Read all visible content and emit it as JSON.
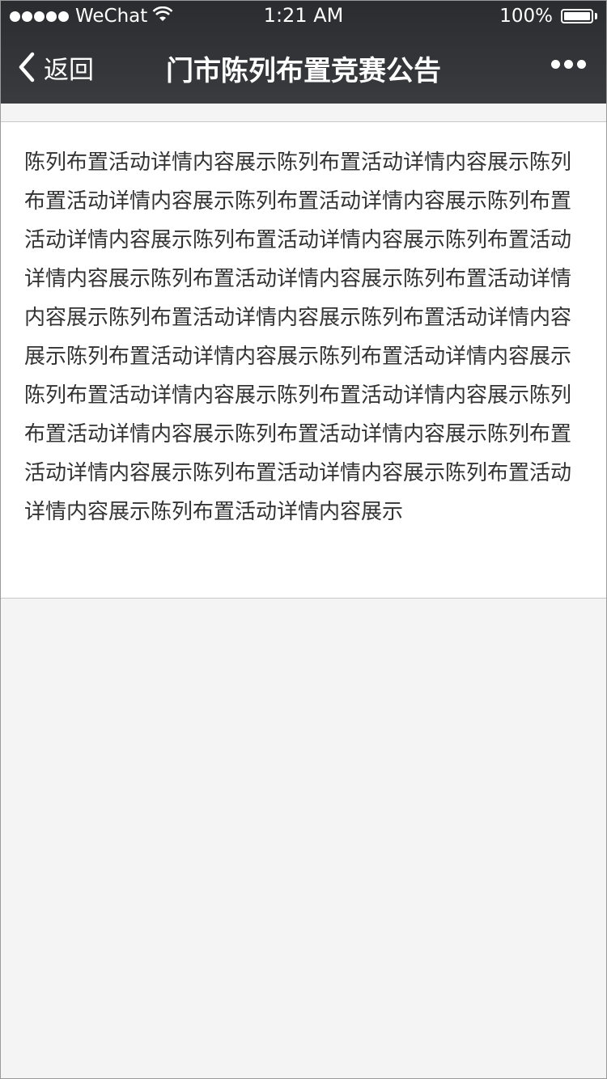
{
  "status_bar": {
    "carrier": "WeChat",
    "time": "1:21 AM",
    "battery": "100%",
    "signal_icon": "signal-dots-icon",
    "wifi_icon": "wifi-icon",
    "battery_icon": "battery-icon"
  },
  "nav": {
    "back_label": "返回",
    "title": "门市陈列布置竞赛公告",
    "more_icon": "more-icon",
    "back_icon": "chevron-left-icon"
  },
  "article": {
    "body": "陈列布置活动详情内容展示陈列布置活动详情内容展示陈列布置活动详情内容展示陈列布置活动详情内容展示陈列布置活动详情内容展示陈列布置活动详情内容展示陈列布置活动详情内容展示陈列布置活动详情内容展示陈列布置活动详情内容展示陈列布置活动详情内容展示陈列布置活动详情内容展示陈列布置活动详情内容展示陈列布置活动详情内容展示陈列布置活动详情内容展示陈列布置活动详情内容展示陈列布置活动详情内容展示陈列布置活动详情内容展示陈列布置活动详情内容展示陈列布置活动详情内容展示陈列布置活动详情内容展示陈列布置活动详情内容展示"
  },
  "colors": {
    "nav_background": "#2e2f33",
    "page_background": "#f4f4f4",
    "text": "#333333"
  }
}
